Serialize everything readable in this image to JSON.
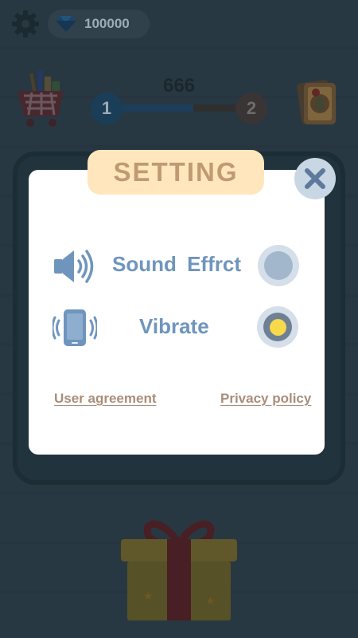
{
  "hud": {
    "gem_count": "100000",
    "current_level": "1",
    "next_level": "2",
    "score": "666",
    "level_progress": 0.62
  },
  "dialog": {
    "title": "SETTING",
    "sound_label": "Sound Effrct",
    "sound_enabled": false,
    "vibrate_label": "Vibrate",
    "vibrate_enabled": true,
    "user_agreement_link": "User agreement",
    "privacy_policy_link": "Privacy policy"
  },
  "colors": {
    "accent_blue": "#6f95bd",
    "title_tab": "#ffe6bd",
    "toggle_on": "#f7d94b",
    "link": "#a88e7b"
  },
  "icons": {
    "settings": "gear-icon",
    "currency": "diamond-icon",
    "shop": "shopping-cart-icon",
    "reward": "money-card-icon",
    "close": "close-icon",
    "sound": "speaker-icon",
    "vibrate": "phone-vibrate-icon",
    "bonus": "gift-box-icon"
  }
}
